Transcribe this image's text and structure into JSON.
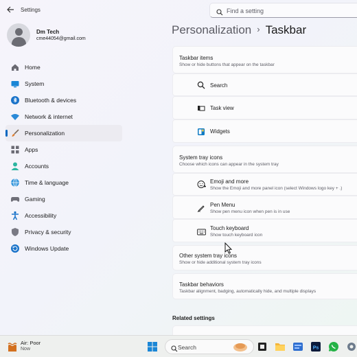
{
  "window": {
    "title": "Settings"
  },
  "search": {
    "placeholder": "Find a setting"
  },
  "user": {
    "name": "Dm Tech",
    "email": "cme44054@gmail.com"
  },
  "nav": [
    {
      "label": "Home",
      "icon": "home-icon"
    },
    {
      "label": "System",
      "icon": "system-icon"
    },
    {
      "label": "Bluetooth & devices",
      "icon": "bluetooth-icon"
    },
    {
      "label": "Network & internet",
      "icon": "wifi-icon"
    },
    {
      "label": "Personalization",
      "icon": "brush-icon",
      "active": true
    },
    {
      "label": "Apps",
      "icon": "apps-icon"
    },
    {
      "label": "Accounts",
      "icon": "account-icon"
    },
    {
      "label": "Time & language",
      "icon": "globe-icon"
    },
    {
      "label": "Gaming",
      "icon": "gamepad-icon"
    },
    {
      "label": "Accessibility",
      "icon": "accessibility-icon"
    },
    {
      "label": "Privacy & security",
      "icon": "shield-icon"
    },
    {
      "label": "Windows Update",
      "icon": "update-icon"
    }
  ],
  "breadcrumb": {
    "parent": "Personalization",
    "separator": "›",
    "current": "Taskbar"
  },
  "taskbar_items": {
    "title": "Taskbar items",
    "subtitle": "Show or hide buttons that appear on the taskbar",
    "items": [
      {
        "label": "Search",
        "icon": "search-icon"
      },
      {
        "label": "Task view",
        "icon": "task-view-icon"
      },
      {
        "label": "Widgets",
        "icon": "widgets-icon"
      }
    ]
  },
  "system_tray": {
    "title": "System tray icons",
    "subtitle": "Choose which icons can appear in the system tray",
    "items": [
      {
        "label": "Emoji and more",
        "desc": "Show the Emoji and more panel icon (select Windows logo key + .)",
        "icon": "emoji-icon"
      },
      {
        "label": "Pen Menu",
        "desc": "Show pen menu icon when pen is in use",
        "icon": "pen-icon"
      },
      {
        "label": "Touch keyboard",
        "desc": "Show touch keyboard icon",
        "icon": "keyboard-icon"
      }
    ]
  },
  "other_tray": {
    "title": "Other system tray icons",
    "subtitle": "Show or hide additional system tray icons"
  },
  "behaviors": {
    "title": "Taskbar behaviors",
    "subtitle": "Taskbar alignment, badging, automatically hide, and multiple displays"
  },
  "related": {
    "title": "Related settings"
  },
  "taskbar": {
    "weather_title": "Air: Poor",
    "weather_sub": "Now",
    "search_label": "Search"
  },
  "colors": {
    "accent": "#0067c0",
    "active_nav_bg": "#ecebf1"
  }
}
